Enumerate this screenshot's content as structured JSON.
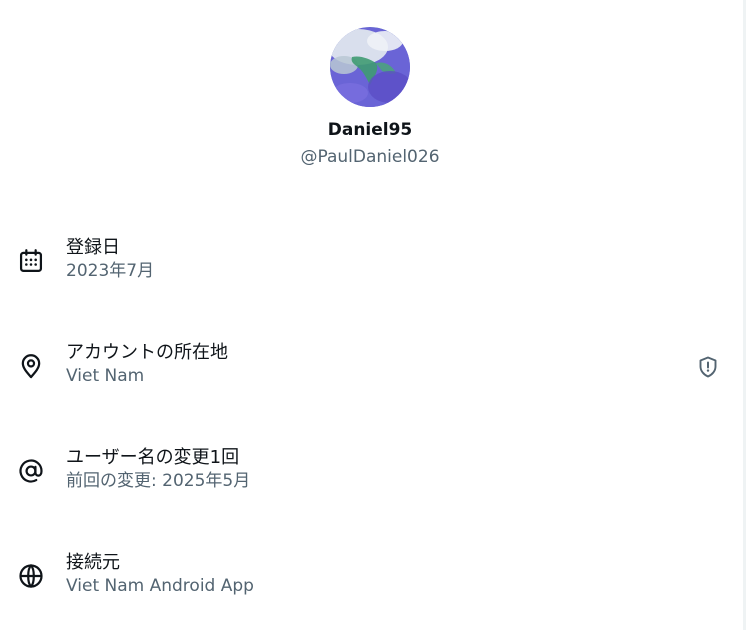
{
  "profile": {
    "display_name": "Daniel95",
    "handle": "@PaulDaniel026"
  },
  "rows": [
    {
      "icon": "calendar-icon",
      "label": "登録日",
      "value": "2023年7月"
    },
    {
      "icon": "location-pin-icon",
      "label": "アカウントの所在地",
      "value": "Viet Nam",
      "trailing_icon": "shield-alert-icon"
    },
    {
      "icon": "at-sign-icon",
      "label": "ユーザー名の変更1回",
      "value": "前回の変更: 2025年5月"
    },
    {
      "icon": "globe-icon",
      "label": "接続元",
      "value": "Viet Nam Android App"
    }
  ],
  "colors": {
    "primary_text": "#0f1419",
    "secondary_text": "#536471",
    "divider": "#eff3f4"
  }
}
